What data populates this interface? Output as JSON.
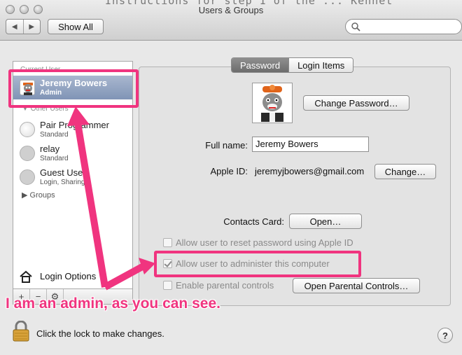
{
  "window": {
    "title": "Users & Groups",
    "background_text": "Instructions for step 1 of the ... Kennet"
  },
  "toolbar": {
    "back_icon": "chevron-left-icon",
    "forward_icon": "chevron-right-icon",
    "show_all_label": "Show All",
    "search_value": ""
  },
  "sidebar": {
    "current_user_header": "Current User",
    "current_user": {
      "name": "Jeremy Bowers",
      "role": "Admin",
      "selected": true
    },
    "other_users_header": "Other Users",
    "other_users": [
      {
        "name": "Pair Programmer",
        "role": "Standard"
      },
      {
        "name": "relay",
        "role": "Standard"
      },
      {
        "name": "Guest User",
        "role": "Login, Sharing"
      }
    ],
    "groups_label": "Groups",
    "login_options_label": "Login Options",
    "footer": {
      "add": "+",
      "remove": "−",
      "action": "⚙"
    }
  },
  "panel": {
    "tabs": [
      {
        "label": "Password",
        "active": true
      },
      {
        "label": "Login Items",
        "active": false
      }
    ],
    "change_password_label": "Change Password…",
    "full_name_label": "Full name:",
    "full_name_value": "Jeremy Bowers",
    "apple_id_label": "Apple ID:",
    "apple_id_value": "jeremyjbowers@gmail.com",
    "change_label": "Change…",
    "contacts_card_label": "Contacts Card:",
    "open_label": "Open…",
    "checkboxes": [
      {
        "label": "Allow user to reset password using Apple ID",
        "checked": false
      },
      {
        "label": "Allow user to administer this computer",
        "checked": true
      },
      {
        "label": "Enable parental controls",
        "checked": false
      }
    ],
    "open_parental_label": "Open Parental Controls…"
  },
  "footer": {
    "lock_text": "Click the lock to make changes.",
    "help_label": "?"
  },
  "annotation": {
    "caption": "I am an admin, as you can see.",
    "color": "#f0347f"
  }
}
